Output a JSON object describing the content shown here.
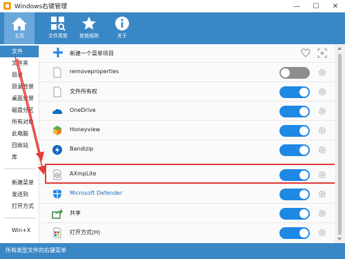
{
  "window": {
    "title": "Windows右键管理",
    "minimize_glyph": "—",
    "maximize_glyph": "☐",
    "close_glyph": "✕"
  },
  "toolbar": {
    "buttons": [
      {
        "label": "主页",
        "icon": "home-icon",
        "active": true
      },
      {
        "label": "文件类型",
        "icon": "file-types-icon",
        "active": false
      },
      {
        "label": "其他规则",
        "icon": "star-icon",
        "active": false
      },
      {
        "label": "关于",
        "icon": "info-icon",
        "active": false
      }
    ]
  },
  "sidebar": {
    "items": [
      {
        "label": "文件",
        "active": true
      },
      {
        "label": "文件夹"
      },
      {
        "label": "目录"
      },
      {
        "label": "目录背景"
      },
      {
        "label": "桌面背景"
      },
      {
        "label": "磁盘分区"
      },
      {
        "label": "所有对象"
      },
      {
        "label": "此电脑"
      },
      {
        "label": "回收站"
      },
      {
        "label": "库"
      },
      {
        "label": "新建菜单"
      },
      {
        "label": "发送到"
      },
      {
        "label": "打开方式"
      },
      {
        "label": "Win+X"
      }
    ]
  },
  "main": {
    "add_item_label": "新建一个菜单项目",
    "rows": [
      {
        "label": "removeproperties",
        "icon": "file-icon",
        "enabled": false,
        "link": false
      },
      {
        "label": "文件所有权",
        "icon": "file-icon",
        "enabled": true,
        "link": false
      },
      {
        "label": "OneDrive",
        "icon": "onedrive-icon",
        "enabled": true,
        "link": false
      },
      {
        "label": "Honeyview",
        "icon": "honeyview-icon",
        "enabled": true,
        "link": false
      },
      {
        "label": "Bandizip",
        "icon": "bandizip-icon",
        "enabled": true,
        "link": false
      },
      {
        "label": "AXmpLite",
        "icon": "axmplite-icon",
        "enabled": true,
        "link": false,
        "highlighted": true
      },
      {
        "label": "Microsoft Defender",
        "icon": "defender-shield-icon",
        "enabled": true,
        "link": true
      },
      {
        "label": "共享",
        "icon": "share-icon",
        "enabled": true,
        "link": false
      },
      {
        "label": "打开方式(H)",
        "icon": "open-with-icon",
        "enabled": true,
        "link": false
      }
    ]
  },
  "statusbar": {
    "text": "所有类型文件的右键菜单"
  },
  "colors": {
    "accent": "#3a87c6",
    "toggle_on": "#1e88e5",
    "toggle_off": "#8d8d8d",
    "highlight": "#e53935",
    "link": "#1e6fc2"
  }
}
